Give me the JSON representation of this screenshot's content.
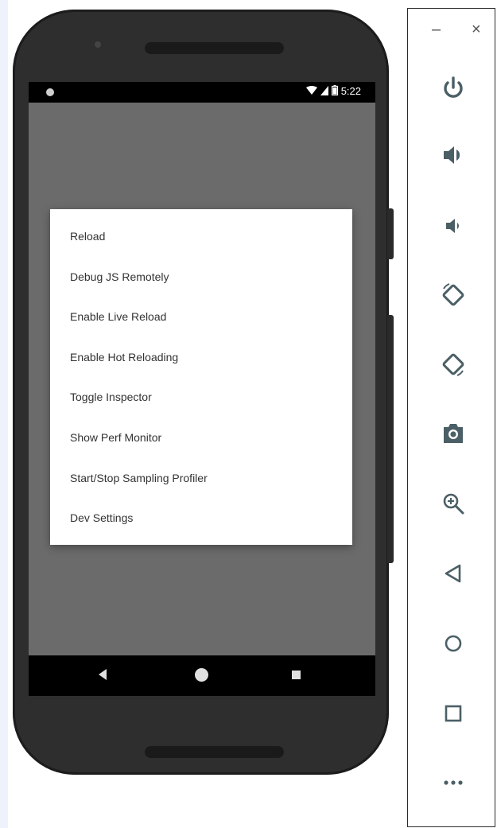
{
  "status_bar": {
    "time": "5:22",
    "wifi_icon": "wifi-icon",
    "signal_icon": "signal-icon",
    "battery_icon": "battery-icon"
  },
  "dev_menu": {
    "items": [
      "Reload",
      "Debug JS Remotely",
      "Enable Live Reload",
      "Enable Hot Reloading",
      "Toggle Inspector",
      "Show Perf Monitor",
      "Start/Stop Sampling Profiler",
      "Dev Settings"
    ]
  },
  "nav_bar": {
    "icons": [
      "back-icon",
      "home-icon",
      "recents-icon"
    ]
  },
  "window_controls": {
    "minimize": "–",
    "close": "×"
  },
  "toolbar": {
    "icons": [
      "power-icon",
      "volume-up-icon",
      "volume-down-icon",
      "rotate-left-icon",
      "rotate-right-icon",
      "camera-icon",
      "zoom-icon",
      "back-icon",
      "home-icon",
      "overview-icon",
      "more-icon"
    ],
    "accent_color": "#4b5f66"
  }
}
